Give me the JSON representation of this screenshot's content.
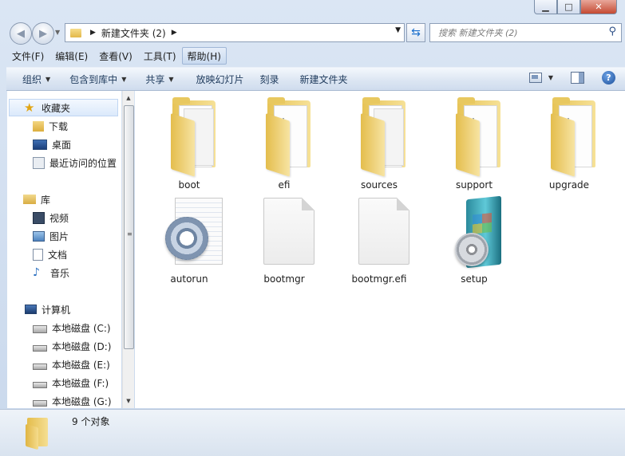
{
  "window": {
    "controls": {
      "minimize": "▁",
      "maximize": "□",
      "close": "✕"
    }
  },
  "nav": {
    "address_segments": [
      "新建文件夹 (2)"
    ],
    "search_placeholder": "搜索 新建文件夹 (2)"
  },
  "menu": [
    "文件(F)",
    "编辑(E)",
    "查看(V)",
    "工具(T)",
    "帮助(H)"
  ],
  "toolbar": {
    "organize": "组织",
    "include_library": "包含到库中",
    "share": "共享",
    "slideshow": "放映幻灯片",
    "burn": "刻录",
    "new_folder": "新建文件夹",
    "help": "?"
  },
  "sidebar": {
    "favorites": {
      "label": "收藏夹",
      "items": [
        "下载",
        "桌面",
        "最近访问的位置"
      ]
    },
    "libraries": {
      "label": "库",
      "items": [
        "视频",
        "图片",
        "文档",
        "音乐"
      ]
    },
    "computer": {
      "label": "计算机",
      "items": [
        "本地磁盘 (C:)",
        "本地磁盘 (D:)",
        "本地磁盘 (E:)",
        "本地磁盘 (F:)",
        "本地磁盘 (G:)"
      ]
    }
  },
  "files": [
    {
      "name": "boot",
      "type": "folder"
    },
    {
      "name": "efi",
      "type": "folder"
    },
    {
      "name": "sources",
      "type": "folder"
    },
    {
      "name": "support",
      "type": "folder"
    },
    {
      "name": "upgrade",
      "type": "folder"
    },
    {
      "name": "autorun",
      "type": "settings-file"
    },
    {
      "name": "bootmgr",
      "type": "file"
    },
    {
      "name": "bootmgr.efi",
      "type": "file"
    },
    {
      "name": "setup",
      "type": "installer"
    }
  ],
  "status": {
    "count": "9 个对象"
  }
}
